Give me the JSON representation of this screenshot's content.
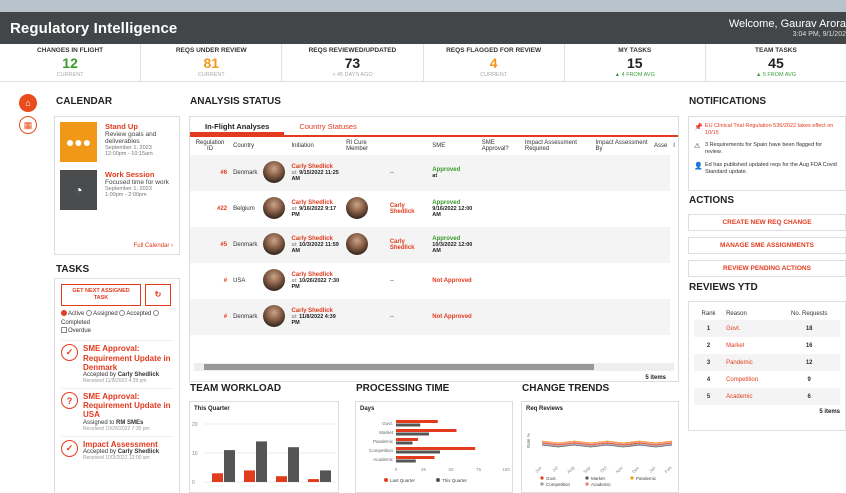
{
  "app": {
    "title": "Regulatory Intelligence",
    "welcome": "Welcome, Gaurav Arora",
    "datetime": "3:04 PM, 9/1/202"
  },
  "kpis": [
    {
      "label": "CHANGES IN FLIGHT",
      "value": "12",
      "sub": "CURRENT",
      "color": "#3a9a2c"
    },
    {
      "label": "REQS UNDER REVIEW",
      "value": "81",
      "sub": "CURRENT",
      "color": "#f29818"
    },
    {
      "label": "REQS REVIEWED/UPDATED",
      "value": "73",
      "sub": "< 45 DAYS AGO",
      "color": "#222222"
    },
    {
      "label": "REQS FLAGGED FOR REVIEW",
      "value": "4",
      "sub": "CURRENT",
      "color": "#f29818"
    },
    {
      "label": "MY TASKS",
      "value": "15",
      "sub": "▲ 4 FROM AVG",
      "color": "#222222"
    },
    {
      "label": "TEAM TASKS",
      "value": "45",
      "sub": "▲ 5 FROM AVG",
      "color": "#222222"
    }
  ],
  "nav": {
    "home_icon": "home-icon",
    "calendar_icon": "calendar-icon"
  },
  "calendar": {
    "heading": "CALENDAR",
    "events": [
      {
        "title": "Stand Up",
        "desc": "Review goals and deliverables",
        "date": "September 1, 2023",
        "time": "12:00pm - 10:15am"
      },
      {
        "title": "Work Session",
        "desc": "Focused time for work",
        "date": "September 1, 2023",
        "time": "1:00pm - 2:00pm"
      }
    ],
    "full_link": "Full Calendar ›"
  },
  "tasks": {
    "heading": "TASKS",
    "get_next": "GET NEXT ASSIGNED TASK",
    "refresh": "↻",
    "filters": [
      "Active",
      "Assigned",
      "Accepted",
      "Completed"
    ],
    "overdue": "Overdue",
    "items": [
      {
        "icon": "✓",
        "title": "SME Approval: Requirement Update in Denmark",
        "line": "Accepted by ",
        "who": "Carly Shedlick",
        "recv": "Received 11/8/2022 4:39 pm"
      },
      {
        "icon": "?",
        "title": "SME Approval: Requirement Update in USA",
        "line": "Assigned to ",
        "who": "RM SMEs",
        "recv": "Received 10/26/2022 7:30 pm"
      },
      {
        "icon": "✓",
        "title": "Impact Assessment",
        "line": "Accepted by ",
        "who": "Carly Shedlick",
        "recv": "Received 10/3/2022 12:00 am"
      }
    ]
  },
  "analysis": {
    "heading": "ANALYSIS STATUS",
    "tabs": [
      "In-Flight Analyses",
      "Country Statuses"
    ],
    "columns": [
      "Regulation ID",
      "Country",
      "Initiation",
      "RI Cure Member",
      "SME",
      "SME Approval?",
      "Impact Assessment Required",
      "Impact Assessment By",
      "Asse",
      "I"
    ],
    "rows": [
      {
        "id": "#6",
        "country": "Denmark",
        "init_name": "Carly Shedlick",
        "init_at": "9/15/2022 11:25 AM",
        "sme": "--",
        "sme_name": "",
        "approval": "Approved",
        "approval_at": "at",
        "ok": true
      },
      {
        "id": "#22",
        "country": "Belgium",
        "init_name": "Carly Shedlick",
        "init_at": "9/16/2022 9:17 PM",
        "sme": "",
        "sme_name": "Carly Shedlick",
        "approval": "Approved",
        "approval_at": "9/16/2022 12:00 AM",
        "ok": true
      },
      {
        "id": "#5",
        "country": "Denmark",
        "init_name": "Carly Shedlick",
        "init_at": "10/3/2022 11:59 AM",
        "sme": "",
        "sme_name": "Carly Shedlick",
        "approval": "Approved",
        "approval_at": "10/3/2022 12:00 AM",
        "ok": true
      },
      {
        "id": "#",
        "country": "USA",
        "init_name": "Carly Shedlick",
        "init_at": "10/26/2022 7:30 PM",
        "sme": "--",
        "sme_name": "",
        "approval": "Not Approved",
        "approval_at": "",
        "ok": false
      },
      {
        "id": "#",
        "country": "Denmark",
        "init_name": "Carly Shedlick",
        "init_at": "11/8/2022 4:39 PM",
        "sme": "--",
        "sme_name": "",
        "approval": "Not Approved",
        "approval_at": "",
        "ok": false
      }
    ],
    "at_label": "at:",
    "items": "5 items"
  },
  "workload": {
    "heading": "TEAM WORKLOAD",
    "subtitle": "This Quarter",
    "y_ticks": [
      "20",
      "10",
      "0"
    ],
    "values_red": [
      3,
      4,
      2,
      1
    ],
    "values_gray": [
      11,
      14,
      12,
      4
    ]
  },
  "processing": {
    "heading": "PROCESSING TIME",
    "subtitle": "Days",
    "categories": [
      "Govt.",
      "Market",
      "Pandemic",
      "Competition",
      "Academic"
    ],
    "x_ticks": [
      "0",
      "25",
      "50",
      "75",
      "100"
    ],
    "last": [
      38,
      55,
      20,
      72,
      35
    ],
    "this": [
      22,
      30,
      15,
      40,
      18
    ],
    "legend": [
      "Last Quarter",
      "This Quarter"
    ]
  },
  "trends": {
    "heading": "CHANGE TRENDS",
    "subtitle": "Req Reviews",
    "ylabel": "Rate %",
    "months": [
      "Jun",
      "Jul",
      "Aug",
      "Sep",
      "Oct",
      "Nov",
      "Dec",
      "Jan",
      "Feb"
    ],
    "legend": [
      "Govt.",
      "Market",
      "Pandemic",
      "Competition",
      "Academic"
    ]
  },
  "notifications": {
    "heading": "NOTIFICATIONS",
    "items": [
      {
        "icon": "📌",
        "text": "EU Clinical Trial Regulation 536/2022 takes effect on 10/15",
        "red": true
      },
      {
        "icon": "⚠",
        "text": "3 Requirements for Spain have been flagged for review.",
        "red": false
      },
      {
        "icon": "👤",
        "text": "Ed has published updated reqs for the Aug FDA Covid Standard update.",
        "red": false
      }
    ]
  },
  "actions": {
    "heading": "ACTIONS",
    "buttons": [
      "CREATE NEW REQ CHANGE",
      "MANAGE SME ASSIGNMENTS",
      "REVIEW PENDING ACTIONS"
    ]
  },
  "reviews": {
    "heading": "REVIEWS YTD",
    "columns": [
      "Rank",
      "Reason",
      "No. Requests"
    ],
    "rows": [
      {
        "rank": "1",
        "reason": "Govt.",
        "n": "18"
      },
      {
        "rank": "2",
        "reason": "Market",
        "n": "16"
      },
      {
        "rank": "3",
        "reason": "Pandemic",
        "n": "12"
      },
      {
        "rank": "4",
        "reason": "Competition",
        "n": "9"
      },
      {
        "rank": "5",
        "reason": "Academic",
        "n": "6"
      }
    ],
    "items": "5 items"
  }
}
